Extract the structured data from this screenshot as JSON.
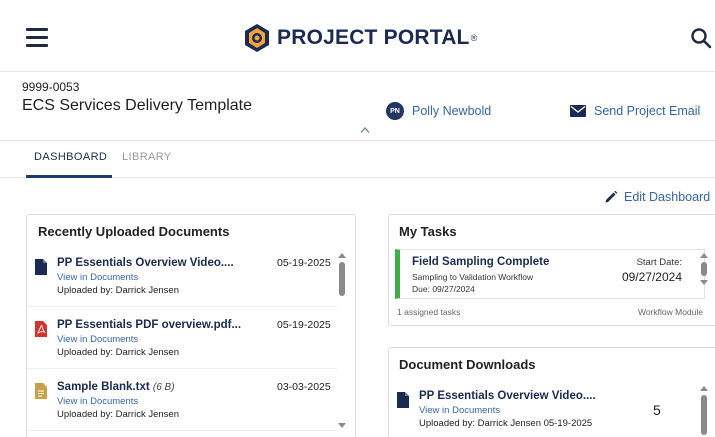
{
  "header": {
    "logo_text": "PROJECT PORTAL",
    "logo_tm": "®"
  },
  "project": {
    "id": "9999-0053",
    "name": "ECS Services Delivery Template",
    "manager_initials": "PN",
    "manager_name": "Polly Newbold",
    "send_email_label": "Send Project Email"
  },
  "tabs": [
    {
      "label": "DASHBOARD",
      "active": true
    },
    {
      "label": "LIBRARY",
      "active": false
    }
  ],
  "edit_dashboard_label": "Edit Dashboard",
  "recent_documents": {
    "title": "Recently Uploaded Documents",
    "items": [
      {
        "title": "PP Essentials Overview Video....",
        "size": "",
        "link": "View in Documents",
        "uploaded_by": "Uploaded by: Darrick Jensen",
        "date": "05-19-2025",
        "icon": "file-icon"
      },
      {
        "title": "PP Essentials PDF overview.pdf...",
        "size": "",
        "link": "View in Documents",
        "uploaded_by": "Uploaded by: Darrick Jensen",
        "date": "05-19-2025",
        "icon": "pdf-icon"
      },
      {
        "title": "Sample Blank.txt",
        "size": "(6 B)",
        "link": "View in Documents",
        "uploaded_by": "Uploaded by: Darrick Jensen",
        "date": "03-03-2025",
        "icon": "text-file-icon"
      }
    ]
  },
  "my_tasks": {
    "title": "My Tasks",
    "task": {
      "title": "Field Sampling Complete",
      "workflow": "Sampling to Validation Workflow",
      "due": "Due: 09/27/2024",
      "start_label": "Start Date:",
      "start_value": "09/27/2024",
      "status_color": "#3fae49"
    },
    "count_text": "1 assigned tasks",
    "module_text": "Workflow Module"
  },
  "document_downloads": {
    "title": "Document Downloads",
    "items": [
      {
        "title": "PP Essentials Overview Video....",
        "link": "View in Documents",
        "uploaded_by": "Uploaded by: Darrick Jensen 05-19-2025",
        "count": "5"
      }
    ]
  },
  "colors": {
    "brand_navy": "#1a2a52",
    "link_blue": "#3566a8",
    "logo_orange": "#f2a33a"
  }
}
